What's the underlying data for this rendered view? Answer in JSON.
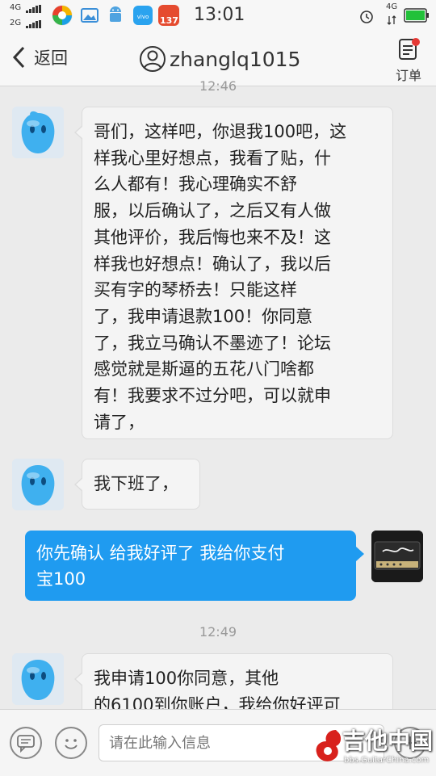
{
  "status_bar": {
    "net_top": "4G",
    "net_bottom": "2G",
    "time": "13:01",
    "badge": "137",
    "net_right": "4G"
  },
  "header": {
    "back_label": "返回",
    "title": "zhanglq1015",
    "order_label": "订单"
  },
  "messages": [
    {
      "timestamp": "12:46"
    },
    {
      "direction": "in",
      "lines": [
        "哥们，这样吧，你退我100吧，这",
        "样我心里好想点，我看了贴，什",
        "么人都有！我心理确实不舒",
        "服，以后确认了，之后又有人做",
        "其他评价，我后悔也来不及！这",
        "样我也好想点！确认了，我以后",
        "买有字的琴桥去！只能这样",
        "了，我申请退款100！你同意",
        "了，我立马确认不墨迹了！论坛",
        "感觉就是斯逼的五花八门啥都",
        "有！我要求不过分吧，可以就申",
        "请了，"
      ]
    },
    {
      "direction": "in",
      "lines": [
        "我下班了，"
      ]
    },
    {
      "direction": "out",
      "lines": [
        "你先确认  给我好评了  我给你支付",
        "宝100"
      ]
    },
    {
      "timestamp": "12:49"
    },
    {
      "direction": "in",
      "lines": [
        "我申请100你同意，其他",
        "的6100到你账户，我给你好评可"
      ]
    }
  ],
  "input": {
    "placeholder": "请在此输入信息"
  },
  "watermark": {
    "text": "吉他中国",
    "url": "bbs.GuitarChina.com"
  },
  "colors": {
    "accent": "#1f9bf0",
    "background": "#ebebeb",
    "battery": "#22c13a"
  }
}
